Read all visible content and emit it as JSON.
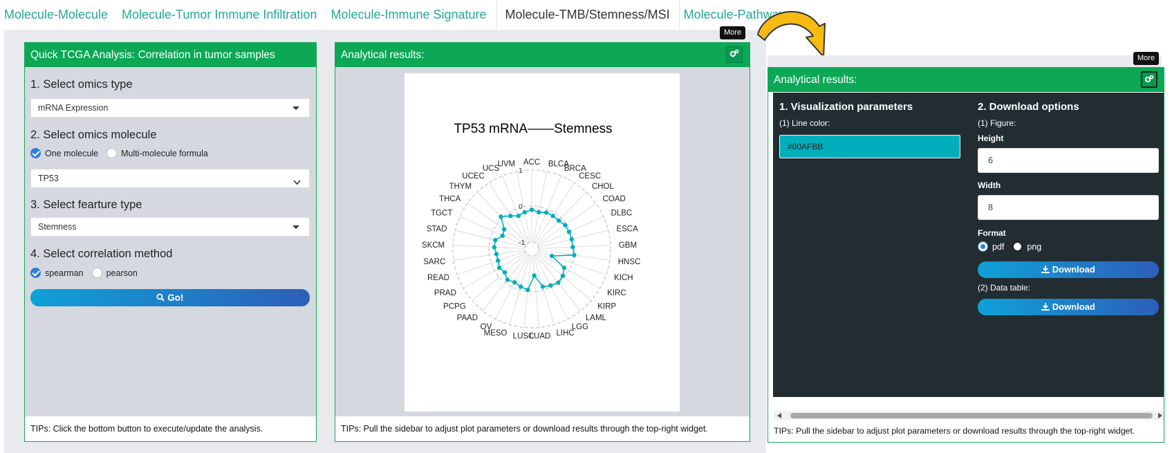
{
  "tabs": [
    {
      "label": "Molecule-Molecule"
    },
    {
      "label": "Molecule-Tumor Immune Infiltration"
    },
    {
      "label": "Molecule-Immune Signature"
    },
    {
      "label": "Molecule-TMB/Stemness/MSI"
    },
    {
      "label": "Molecule-Pathway"
    }
  ],
  "sidebar": {
    "title": "Quick TCGA Analysis: Correlation in tumor samples",
    "step1_label": "1. Select omics type",
    "omics_type": "mRNA Expression",
    "step2_label": "2. Select omics molecule",
    "molecule_options": [
      "One molecule",
      "Multi-molecule formula"
    ],
    "molecule": "TP53",
    "step3_label": "3. Select fearture type",
    "feature_type": "Stemness",
    "step4_label": "4. Select correlation method",
    "method_options": [
      "spearman",
      "pearson"
    ],
    "go_label": "Go!",
    "tips": "TIPs: Click the bottom button to execute/update the analysis."
  },
  "results": {
    "title": "Analytical results:",
    "tooltip": "More",
    "tips": "TIPs: Pull the sidebar to adjust plot parameters or download results through the top-right widget."
  },
  "chart_data": {
    "type": "radar",
    "title": "TP53 mRNA——Stemness",
    "line_color": "#00AFBB",
    "range": [
      -1,
      1
    ],
    "ring_labels": [
      "-1",
      "0",
      "1"
    ],
    "categories": [
      "ACC",
      "BLCA",
      "BRCA",
      "CESC",
      "CHOL",
      "COAD",
      "DLBC",
      "ESCA",
      "GBM",
      "HNSC",
      "KICH",
      "KIRC",
      "KIRP",
      "LAML",
      "LGG",
      "LIHC",
      "LUAD",
      "LUSC",
      "MESO",
      "OV",
      "PAAD",
      "PCPG",
      "PRAD",
      "READ",
      "SARC",
      "SKCM",
      "STAD",
      "TGCT",
      "THCA",
      "THYM",
      "UCEC",
      "UCS",
      "UVM"
    ],
    "values": [
      -0.1,
      -0.15,
      -0.1,
      -0.1,
      -0.1,
      -0.05,
      -0.05,
      -0.05,
      -0.05,
      0.0,
      -0.6,
      -0.15,
      -0.05,
      0.0,
      -0.05,
      -0.1,
      -0.45,
      -0.05,
      -0.1,
      -0.15,
      -0.1,
      -0.2,
      -0.15,
      -0.2,
      -0.2,
      -0.15,
      -0.15,
      -0.3,
      -0.25,
      0.05,
      -0.1,
      -0.2,
      -0.15
    ]
  },
  "settings_panel": {
    "title": "Analytical results:",
    "tooltip": "More",
    "viz_heading": "1. Visualization parameters",
    "line_color_label": "(1) Line color:",
    "line_color_value": "#00AFBB",
    "download_heading": "2. Download options",
    "figure_label": "(1) Figure:",
    "height_label": "Height",
    "height_value": "6",
    "width_label": "Width",
    "width_value": "8",
    "format_label": "Format",
    "format_options": [
      "pdf",
      "png"
    ],
    "download_label": "Download",
    "data_table_label": "(2) Data table:",
    "download2_label": "Download",
    "tips": "TIPs: Pull the sidebar to adjust plot parameters or download results through the top-right widget."
  }
}
